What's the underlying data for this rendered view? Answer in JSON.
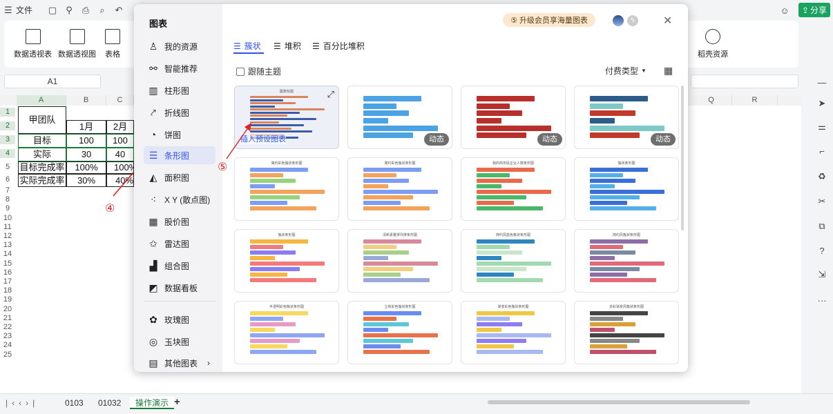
{
  "topbar": {
    "file_label": "文件",
    "share_label": "分享"
  },
  "ribbon": {
    "items": [
      {
        "label": "数据透视表"
      },
      {
        "label": "数据透视图"
      },
      {
        "label": "表格"
      },
      {
        "label": "稻壳资源"
      }
    ]
  },
  "namebox": {
    "value": "A1"
  },
  "grid": {
    "columns": [
      "A",
      "B",
      "C",
      "Q",
      "R"
    ],
    "rows": [
      "1",
      "2",
      "3",
      "4",
      "5",
      "6",
      "7",
      "8",
      "9",
      "10",
      "11",
      "12",
      "13",
      "14",
      "15",
      "16",
      "17",
      "18",
      "19",
      "20",
      "21",
      "22",
      "23",
      "24",
      "25"
    ],
    "cells": {
      "team": "甲团队",
      "m1": "1月",
      "m2": "2月",
      "target": "目标",
      "actual": "实际",
      "target_rate": "目标完成率",
      "actual_rate": "实际完成率",
      "t1": "100",
      "t2": "100",
      "a1": "30",
      "a2": "40",
      "tr1": "100%",
      "tr2": "100%",
      "ar1": "30%",
      "ar2": "40%"
    }
  },
  "sheet_tabs": [
    "0103",
    "01032",
    "操作演示"
  ],
  "dialog": {
    "title": "图表",
    "upgrade_label": "升级会员享海量图表",
    "sidebar": [
      {
        "label": "我的资源"
      },
      {
        "label": "智能推荐"
      },
      {
        "label": "柱形图"
      },
      {
        "label": "折线图"
      },
      {
        "label": "饼图"
      },
      {
        "label": "条形图"
      },
      {
        "label": "面积图"
      },
      {
        "label": "X Y (散点图)"
      },
      {
        "label": "股价图"
      },
      {
        "label": "雷达图"
      },
      {
        "label": "组合图"
      },
      {
        "label": "数据看板"
      },
      {
        "label": "玫瑰图"
      },
      {
        "label": "玉块图"
      },
      {
        "label": "其他图表"
      }
    ],
    "tabs": [
      {
        "label": "簇状"
      },
      {
        "label": "堆积"
      },
      {
        "label": "百分比堆积"
      }
    ],
    "follow_theme_label": "跟随主题",
    "paid_type_label": "付费类型",
    "insert_preset_label": "插入预设图表",
    "dynamic_badge": "动态",
    "thumbnails": [
      {
        "title": "图表标题"
      },
      {
        "title": ""
      },
      {
        "title": ""
      },
      {
        "title": ""
      },
      {
        "title": "简约彩色簇状条形图"
      },
      {
        "title": "简约彩色簇状条形图"
      },
      {
        "title": "我的商务民企业人数条形图"
      },
      {
        "title": "簇状条形图"
      },
      {
        "title": "簇状条形图"
      },
      {
        "title": "清新素雅排列排条形图"
      },
      {
        "title": "简约风蓝色簇状条形图"
      },
      {
        "title": "简约风簇状条形图"
      },
      {
        "title": "半透明彩色簇状条形图"
      },
      {
        "title": "立体彩色簇状条形图"
      },
      {
        "title": "渐变彩色簇状条形图"
      },
      {
        "title": "多彩渐变风簇状条形图"
      }
    ]
  },
  "annotations": {
    "step4": "④",
    "step5": "⑤"
  }
}
